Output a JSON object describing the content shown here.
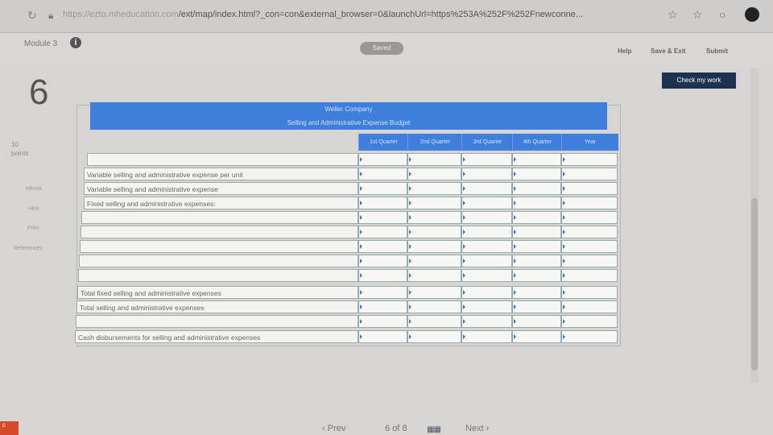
{
  "browser": {
    "url_host": "https://ezto.mheducation.com",
    "url_path": "/ext/map/index.html?_con=con&external_browser=0&launchUrl=https%253A%252F%252Fnewconne..."
  },
  "header": {
    "module_label": "Module 3",
    "saved_label": "Saved",
    "help_label": "Help",
    "save_exit_label": "Save & Exit",
    "submit_label": "Submit"
  },
  "question": {
    "number": "6",
    "points_value": "10",
    "points_label": "points",
    "check_label": "Check my work",
    "side_links": [
      "eBook",
      "Hint",
      "Print",
      "References"
    ]
  },
  "worksheet": {
    "company": "Weller Company",
    "title": "Selling and Administrative Expense Budget",
    "columns": [
      "1st Quarter",
      "2nd Quarter",
      "3rd Quarter",
      "4th Quarter",
      "Year"
    ],
    "rows": [
      {
        "label": ""
      },
      {
        "label": "Variable selling and administrative expense per unit"
      },
      {
        "label": "Variable selling and administrative expense"
      },
      {
        "label": "Fixed selling and administrative expenses:"
      },
      {
        "label": ""
      },
      {
        "label": ""
      },
      {
        "label": ""
      },
      {
        "label": ""
      },
      {
        "label": ""
      },
      {
        "label": "Total fixed selling and administrative expenses"
      },
      {
        "label": "Total selling and administrative expenses"
      },
      {
        "label": ""
      },
      {
        "label": "Cash disbursements for selling and administrative expenses"
      }
    ]
  },
  "footer": {
    "prev_label": "Prev",
    "page_current": "6",
    "page_of": "of",
    "page_total": "8",
    "next_label": "Next"
  },
  "colors": {
    "header_blue": "#3f7fdb",
    "check_button": "#1e3352"
  }
}
